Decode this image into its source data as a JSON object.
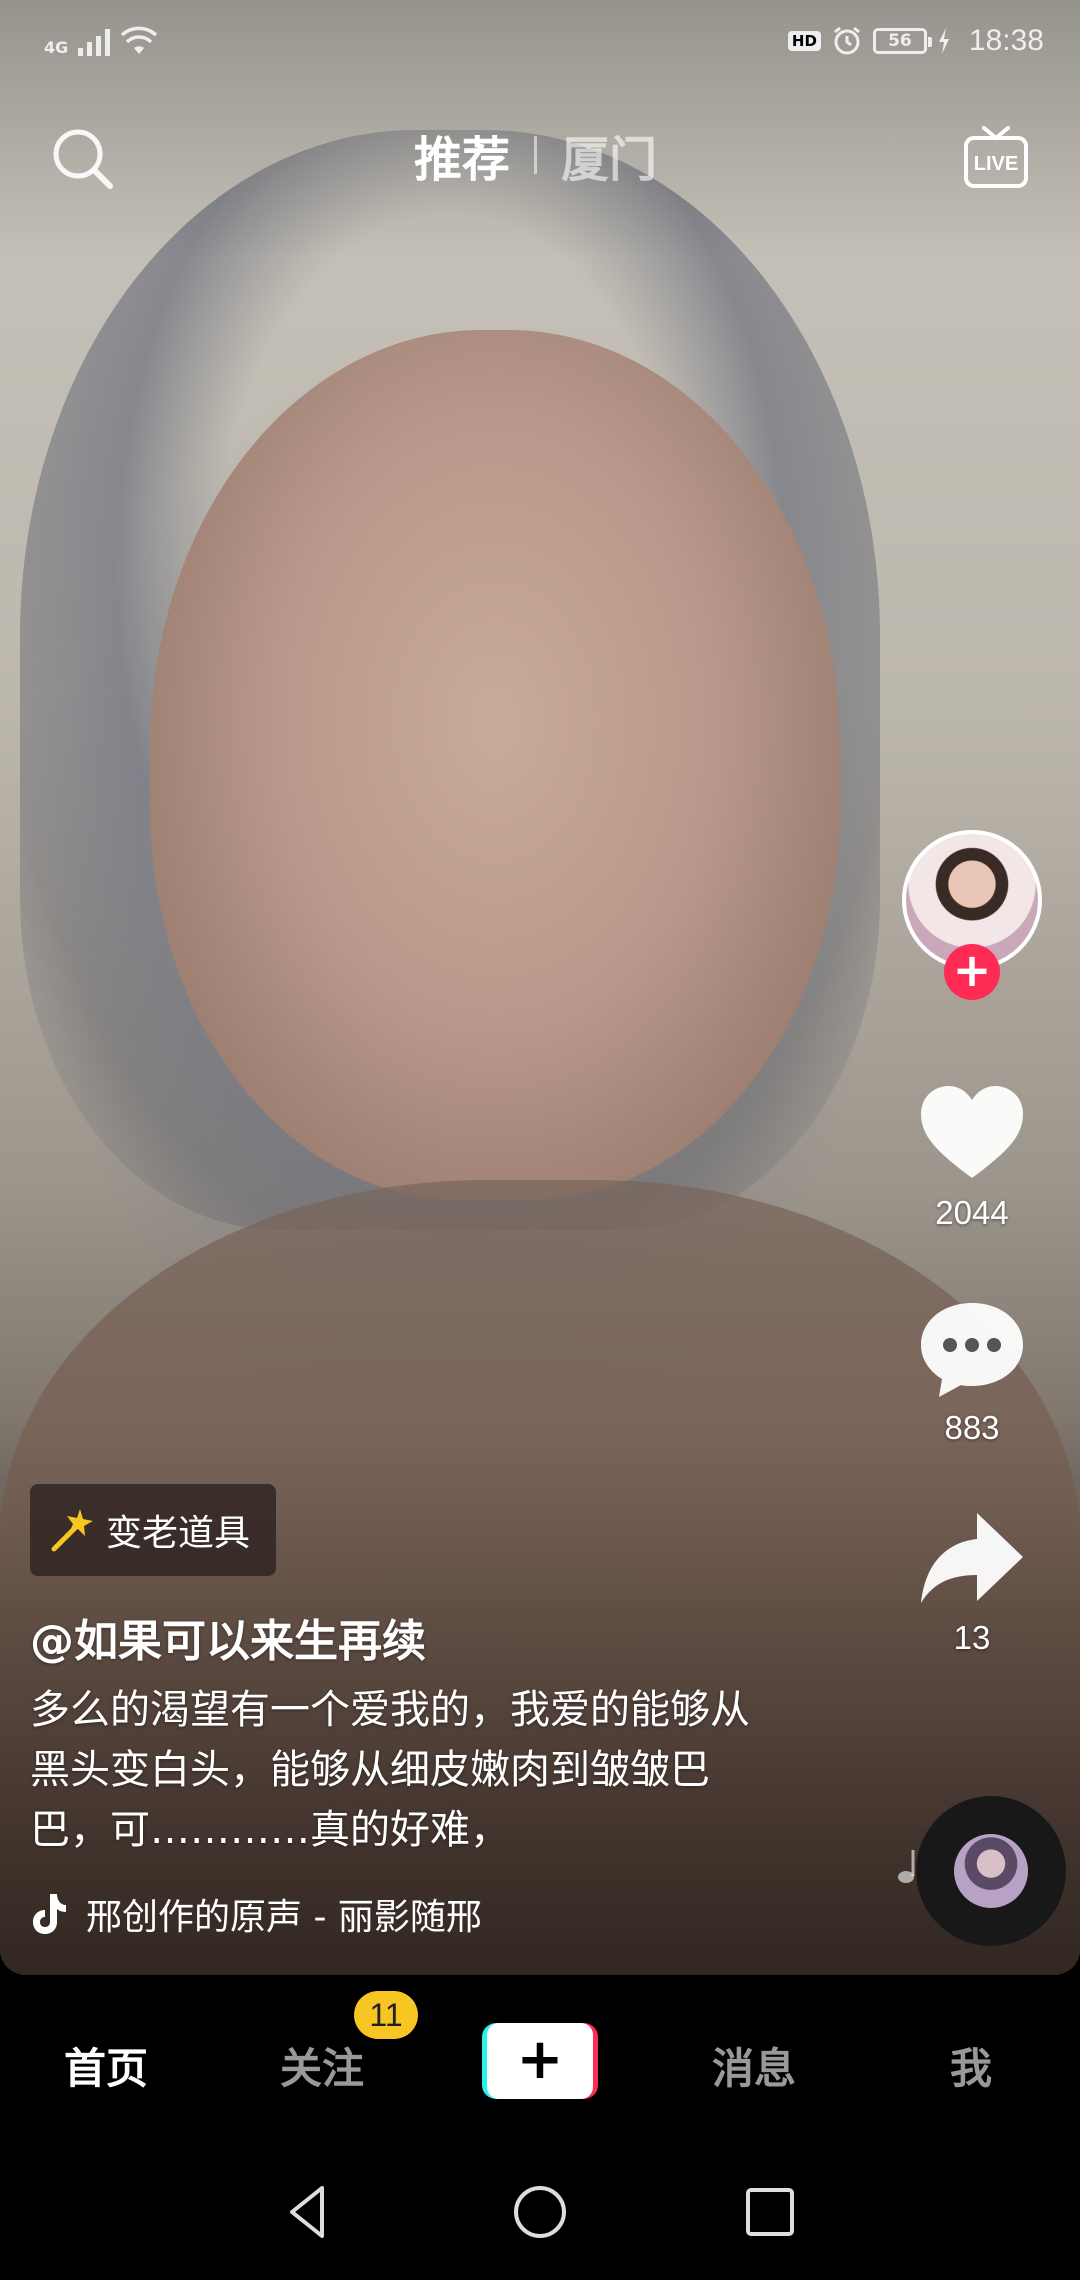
{
  "status_bar": {
    "network": "4G",
    "hd": "HD",
    "battery": "56",
    "time": "18:38"
  },
  "top_nav": {
    "tabs": [
      {
        "label": "推荐",
        "active": true
      },
      {
        "label": "厦门",
        "active": false
      }
    ],
    "icons": {
      "search": "search-icon",
      "live": "live-icon"
    }
  },
  "rail": {
    "likes": "2044",
    "comments": "883",
    "shares": "13",
    "follow_symbol": "+"
  },
  "caption": {
    "effect_label": "变老道具",
    "author": "@如果可以来生再续",
    "description": "多么的渴望有一个爱我的，我爱的能够从黑头变白头，能够从细皮嫩肉到皱皱巴巴，可…………真的好难，",
    "music": "邢创作的原声 - 丽影随邢"
  },
  "tab_bar": {
    "home": "首页",
    "follow": "关注",
    "follow_badge": "11",
    "create": "+",
    "messages": "消息",
    "me": "我"
  },
  "colors": {
    "accent_red": "#fe2c55",
    "accent_cyan": "#25f4ee",
    "badge_yellow": "#f8c623"
  }
}
